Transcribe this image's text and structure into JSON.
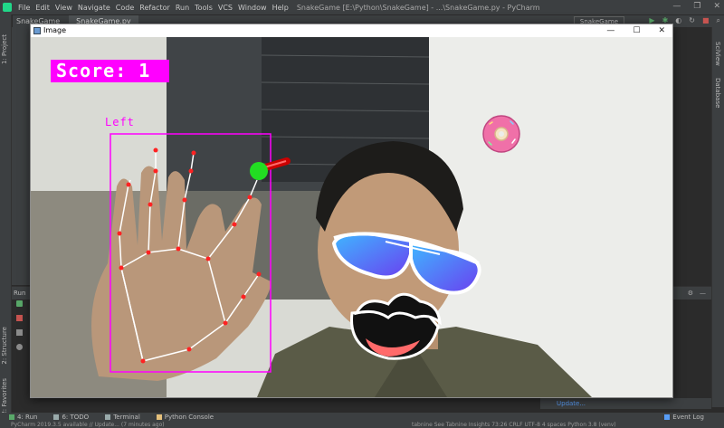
{
  "menubar": {
    "items": [
      {
        "label": "File"
      },
      {
        "label": "Edit"
      },
      {
        "label": "View"
      },
      {
        "label": "Navigate"
      },
      {
        "label": "Code"
      },
      {
        "label": "Refactor"
      },
      {
        "label": "Run"
      },
      {
        "label": "Tools"
      },
      {
        "label": "VCS"
      },
      {
        "label": "Window"
      },
      {
        "label": "Help"
      }
    ],
    "title": "SnakeGame [E:\\Python\\SnakeGame] - ...\\SnakeGame.py - PyCharm"
  },
  "navbar": {
    "project": "SnakeGame",
    "file_tab": "SnakeGame.py",
    "run_config": "SnakeGame"
  },
  "left_strip": {
    "project_tab": "1: Project",
    "structure_tab": "2: Structure",
    "favorites_tab": "2: Favorites"
  },
  "right_strip": {
    "sciview_tab": "SciView",
    "database_tab": "Database"
  },
  "run_panel": {
    "label": "Run"
  },
  "image_window": {
    "title": "Image",
    "minimize": "—",
    "maximize": "☐",
    "close": "✕"
  },
  "game": {
    "score_text": "Score: 1",
    "hand_label": "Left",
    "accent_color": "#ff00ff",
    "head_color": "#22dd22",
    "body_color": "#cc0000"
  },
  "bottom_tabs": {
    "run": "4: Run",
    "todo": "6: TODO",
    "terminal": "Terminal",
    "python_console": "Python Console",
    "event_log": "Event Log"
  },
  "event_panel": {
    "link": "Update..."
  },
  "statusbar": {
    "left": "PyCharm 2019.3.5 available // Update... (7 minutes ago)",
    "right": "tabnine   See Tabnine Insights   73:26   CRLF   UTF-8   4 spaces   Python 3.8 (venv)"
  }
}
